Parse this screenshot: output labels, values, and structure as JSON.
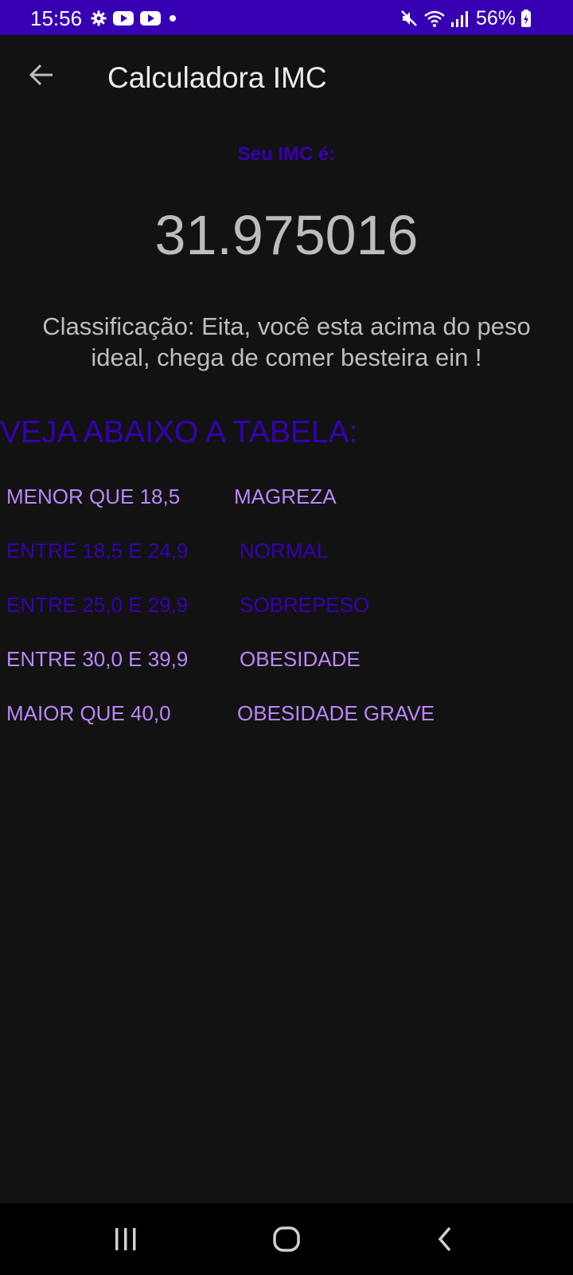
{
  "status_bar": {
    "time": "15:56",
    "battery": "56%",
    "left_icons": [
      "gear-icon",
      "youtube-icon",
      "youtube-icon",
      "dot-icon"
    ],
    "right_icons": [
      "mute-icon",
      "wifi-icon",
      "signal-icon",
      "battery-icon"
    ],
    "color": "#3700b3"
  },
  "app_bar": {
    "title": "Calculadora IMC",
    "back_icon": "arrow-back-icon"
  },
  "result": {
    "label": "Seu IMC é:",
    "value": "31.975016",
    "classification": "Classificação: Eita, você esta acima do peso ideal, chega de comer besteira ein !"
  },
  "table": {
    "title": "VEJA ABAIXO A TABELA:",
    "rows": [
      {
        "range": "MENOR QUE 18,5",
        "class": "MAGREZA"
      },
      {
        "range": "ENTRE 18,5 E 24,9",
        "class": "NORMAL"
      },
      {
        "range": "ENTRE 25,0 E 29,9",
        "class": "SOBREPESO"
      },
      {
        "range": "ENTRE 30,0 E 39,9",
        "class": "OBESIDADE"
      },
      {
        "range": "MAIOR QUE 40,0",
        "class": "OBESIDADE GRAVE"
      }
    ]
  },
  "colors": {
    "primary": "#3700b3",
    "accent": "#bb86fc",
    "background": "#121212"
  },
  "nav_bar": {
    "buttons": [
      "recent-apps-icon",
      "home-icon",
      "back-icon"
    ]
  }
}
